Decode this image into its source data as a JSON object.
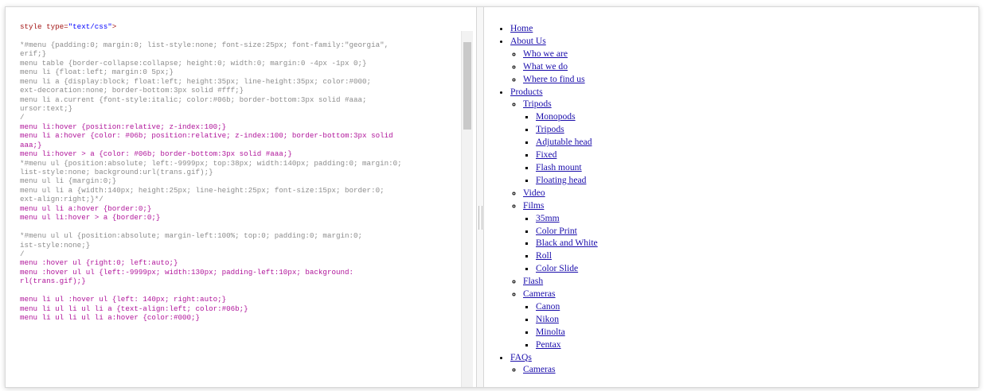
{
  "editor": {
    "lines": [
      {
        "type": "tag",
        "segments": [
          {
            "cls": "tag",
            "text": "style type="
          },
          {
            "cls": "str",
            "text": "\"text/css\""
          },
          {
            "cls": "tag",
            "text": ">"
          }
        ]
      },
      {
        "type": "blank"
      },
      {
        "type": "comment",
        "text": "*#menu {padding:0; margin:0; list-style:none; font-size:25px; font-family:\"georgia\","
      },
      {
        "type": "comment",
        "text": "erif;}"
      },
      {
        "type": "comment",
        "text": "menu table {border-collapse:collapse; height:0; width:0; margin:0 -4px -1px 0;}"
      },
      {
        "type": "comment",
        "text": "menu li {float:left; margin:0 5px;}"
      },
      {
        "type": "comment",
        "text": "menu li a {display:block; float:left; height:35px; line-height:35px; color:#000;"
      },
      {
        "type": "comment",
        "text": "ext-decoration:none; border-bottom:3px solid #fff;}"
      },
      {
        "type": "comment",
        "text": "menu li a.current {font-style:italic; color:#06b; border-bottom:3px solid #aaa;"
      },
      {
        "type": "comment",
        "text": "ursor:text;}"
      },
      {
        "type": "comment",
        "text": "/"
      },
      {
        "type": "active",
        "text": "menu li:hover {position:relative; z-index:100;}"
      },
      {
        "type": "active",
        "text": "menu li a:hover {color: #06b; position:relative; z-index:100; border-bottom:3px solid"
      },
      {
        "type": "active",
        "text": "aaa;}"
      },
      {
        "type": "active",
        "text": "menu li:hover > a {color: #06b; border-bottom:3px solid #aaa;}"
      },
      {
        "type": "comment",
        "text": "*#menu ul {position:absolute; left:-9999px; top:38px; width:140px; padding:0; margin:0;"
      },
      {
        "type": "comment",
        "text": "list-style:none; background:url(trans.gif);}"
      },
      {
        "type": "comment",
        "text": "menu ul li {margin:0;}"
      },
      {
        "type": "comment",
        "text": "menu ul li a {width:140px; height:25px; line-height:25px; font-size:15px; border:0;"
      },
      {
        "type": "comment",
        "text": "ext-align:right;}*/"
      },
      {
        "type": "active",
        "text": "menu ul li a:hover {border:0;}"
      },
      {
        "type": "active",
        "text": "menu ul li:hover > a {border:0;}"
      },
      {
        "type": "blank"
      },
      {
        "type": "comment",
        "text": "*#menu ul ul {position:absolute; margin-left:100%; top:0; padding:0; margin:0;"
      },
      {
        "type": "comment",
        "text": "ist-style:none;}"
      },
      {
        "type": "comment",
        "text": "/"
      },
      {
        "type": "active",
        "text": "menu :hover ul {right:0; left:auto;}"
      },
      {
        "type": "active",
        "text": "menu :hover ul ul {left:-9999px; width:130px; padding-left:10px; background:"
      },
      {
        "type": "active",
        "text": "rl(trans.gif);}"
      },
      {
        "type": "blank"
      },
      {
        "type": "active",
        "text": "menu li ul :hover ul {left: 140px; right:auto;}"
      },
      {
        "type": "active",
        "text": "menu li ul li ul li a {text-align:left; color:#06b;}"
      },
      {
        "type": "active",
        "text": "menu li ul li ul li a:hover {color:#000;}"
      }
    ]
  },
  "preview": {
    "menu": [
      {
        "label": "Home"
      },
      {
        "label": "About Us",
        "children": [
          {
            "label": "Who we are"
          },
          {
            "label": "What we do"
          },
          {
            "label": "Where to find us"
          }
        ]
      },
      {
        "label": "Products",
        "children": [
          {
            "label": "Tripods",
            "children": [
              {
                "label": "Monopods"
              },
              {
                "label": "Tripods"
              },
              {
                "label": "Adjutable head"
              },
              {
                "label": "Fixed"
              },
              {
                "label": "Flash mount"
              },
              {
                "label": "Floating head"
              }
            ]
          },
          {
            "label": "Video"
          },
          {
            "label": "Films",
            "children": [
              {
                "label": "35mm"
              },
              {
                "label": "Color Print"
              },
              {
                "label": "Black and White"
              },
              {
                "label": "Roll"
              },
              {
                "label": "Color Slide"
              }
            ]
          },
          {
            "label": "Flash"
          },
          {
            "label": "Cameras",
            "children": [
              {
                "label": "Canon"
              },
              {
                "label": "Nikon"
              },
              {
                "label": "Minolta"
              },
              {
                "label": "Pentax"
              }
            ]
          }
        ]
      },
      {
        "label": "FAQs",
        "children": [
          {
            "label": "Cameras"
          }
        ]
      }
    ]
  }
}
